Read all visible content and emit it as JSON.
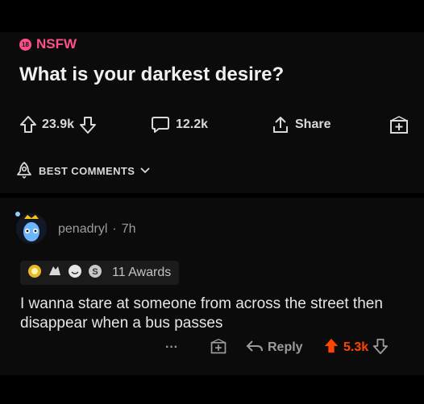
{
  "post": {
    "nsfw_badge": "18",
    "nsfw_label": "NSFW",
    "title": "What is your darkest desire?",
    "upvotes": "23.9k",
    "comments_count": "12.2k",
    "share_label": "Share"
  },
  "comments_header": {
    "sort_label": "BEST COMMENTS"
  },
  "comment": {
    "author": "penadryl",
    "separator": "·",
    "age": "7h",
    "awards_label": "11 Awards",
    "award_icons": [
      "gold-award-icon",
      "hands-award-icon",
      "smile-award-icon",
      "silver-award-icon"
    ],
    "body": "I wanna stare at someone from across the street then disappear when a bus passes",
    "more_label": "···",
    "reply_label": "Reply",
    "score": "5.3k"
  },
  "colors": {
    "nsfw": "#ff4f8b",
    "upvote_active": "#ff4500",
    "text": "#d7dadc",
    "muted": "#9a9da0"
  }
}
